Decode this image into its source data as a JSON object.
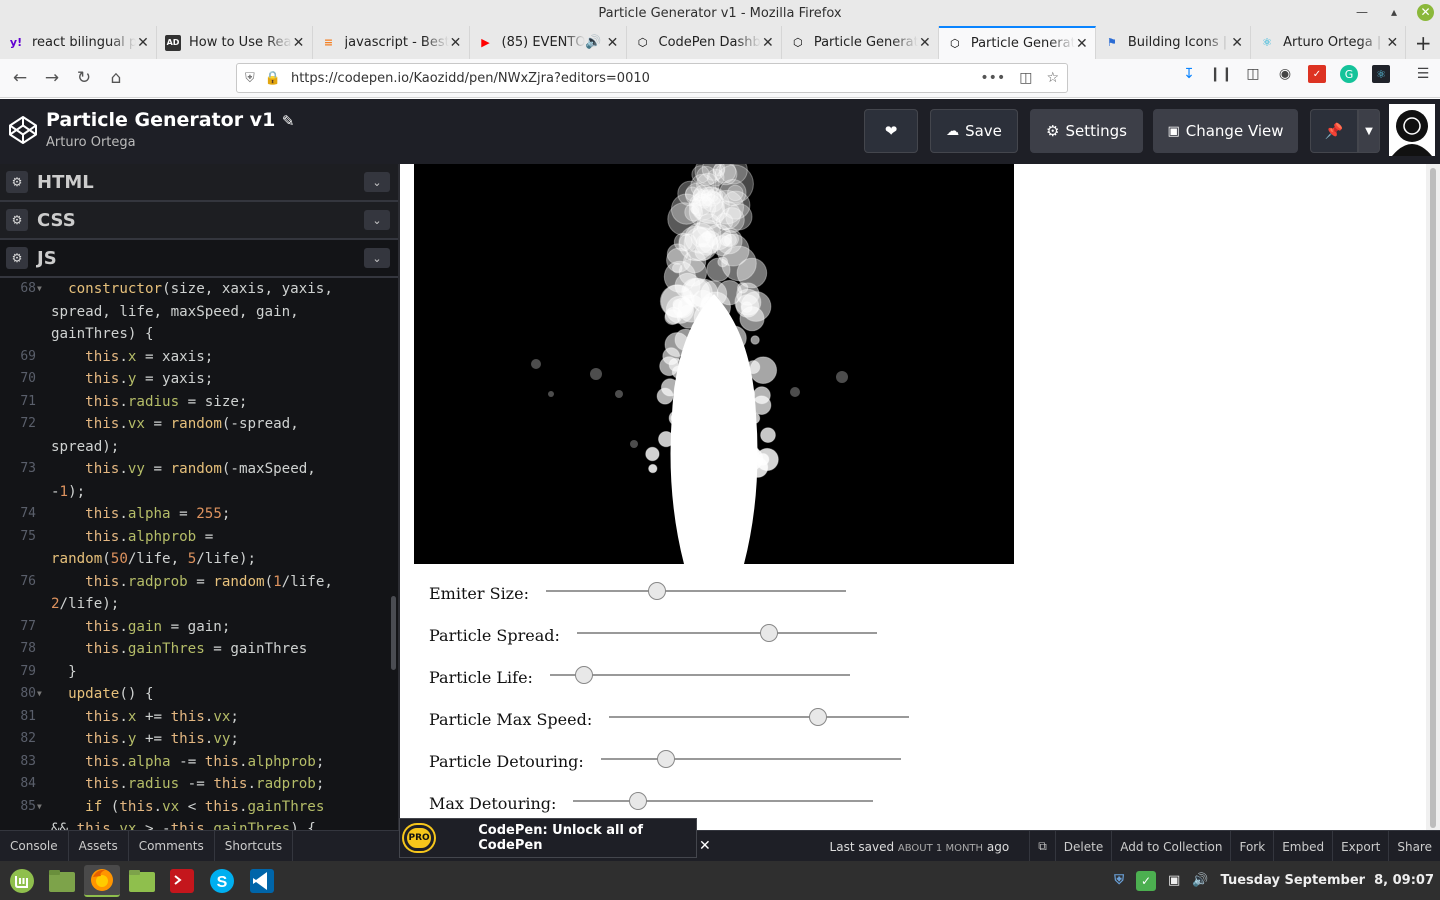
{
  "window": {
    "title": "Particle Generator v1 - Mozilla Firefox"
  },
  "tabs": [
    {
      "label": "react bilingual p",
      "icon": "yahoo-icon",
      "color": "#6001d2"
    },
    {
      "label": "How to Use Rea",
      "icon": "ad-icon",
      "color": "#333333"
    },
    {
      "label": "javascript - Best",
      "icon": "stackoverflow-icon",
      "color": "#f48024"
    },
    {
      "label": "(85) EVENTO",
      "icon": "youtube-icon",
      "color": "#ff0000"
    },
    {
      "label": "CodePen Dashb",
      "icon": "codepen-icon",
      "color": "#000000"
    },
    {
      "label": "Particle Generat",
      "icon": "codepen-icon",
      "color": "#000000"
    },
    {
      "label": "Particle Generat",
      "icon": "codepen-icon",
      "color": "#000000",
      "active": true
    },
    {
      "label": "Building Icons |",
      "icon": "flag-icon",
      "color": "#2b6cd4"
    },
    {
      "label": "Arturo Ortega |",
      "icon": "react-icon",
      "color": "#00a9d6"
    }
  ],
  "nav": {
    "url": "https://codepen.io/Kaozidd/pen/NWxZjra?editors=0010"
  },
  "codepen": {
    "title": "Particle Generator v1",
    "author": "Arturo Ortega",
    "buttons": {
      "save": "Save",
      "settings": "Settings",
      "change_view": "Change View"
    }
  },
  "editor": {
    "panels": [
      "HTML",
      "CSS",
      "JS"
    ],
    "lines": [
      {
        "n": "68",
        "fold": true,
        "text": "  constructor(size, xaxis, yaxis,"
      },
      {
        "n": "",
        "text": "spread, life, maxSpeed, gain,"
      },
      {
        "n": "",
        "text": "gainThres) {"
      },
      {
        "n": "69",
        "text": "    this.x = xaxis;"
      },
      {
        "n": "70",
        "text": "    this.y = yaxis;"
      },
      {
        "n": "71",
        "text": "    this.radius = size;"
      },
      {
        "n": "72",
        "text": "    this.vx = random(-spread,"
      },
      {
        "n": "",
        "text": "spread);"
      },
      {
        "n": "73",
        "text": "    this.vy = random(-maxSpeed,"
      },
      {
        "n": "",
        "text": "-1);"
      },
      {
        "n": "74",
        "text": "    this.alpha = 255;"
      },
      {
        "n": "75",
        "text": "    this.alphprob ="
      },
      {
        "n": "",
        "text": "random(50/life, 5/life);"
      },
      {
        "n": "76",
        "text": "    this.radprob = random(1/life,"
      },
      {
        "n": "",
        "text": "2/life);"
      },
      {
        "n": "77",
        "text": "    this.gain = gain;"
      },
      {
        "n": "78",
        "text": "    this.gainThres = gainThres"
      },
      {
        "n": "79",
        "text": "  }"
      },
      {
        "n": "80",
        "fold": true,
        "text": "  update() {"
      },
      {
        "n": "81",
        "text": "    this.x += this.vx;"
      },
      {
        "n": "82",
        "text": "    this.y += this.vy;"
      },
      {
        "n": "83",
        "text": "    this.alpha -= this.alphprob;"
      },
      {
        "n": "84",
        "text": "    this.radius -= this.radprob;"
      },
      {
        "n": "85",
        "fold": true,
        "text": "    if (this.vx < this.gainThres"
      },
      {
        "n": "",
        "text": "&& this.vx > -this.gainThres) {"
      }
    ]
  },
  "controls": [
    {
      "label": "Emiter Size:",
      "value": 0.36
    },
    {
      "label": "Particle Spread:",
      "value": 0.65
    },
    {
      "label": "Particle Life:",
      "value": 0.09
    },
    {
      "label": "Particle Max Speed:",
      "value": 0.71
    },
    {
      "label": "Particle Detouring:",
      "value": 0.2
    },
    {
      "label": "Max Detouring:",
      "value": 0.2
    }
  ],
  "footer": {
    "buttons": [
      "Console",
      "Assets",
      "Comments",
      "Shortcuts"
    ],
    "promo": "CodePen: Unlock all of CodePen",
    "promo_badge": "PRO",
    "saved_prefix": "Last saved",
    "saved_time": "ABOUT 1 MONTH",
    "saved_suffix": "ago",
    "actions": [
      "Delete",
      "Add to Collection",
      "Fork",
      "Embed",
      "Export",
      "Share"
    ]
  },
  "taskbar": {
    "datetime": "Tuesday September  8, 09:07"
  }
}
